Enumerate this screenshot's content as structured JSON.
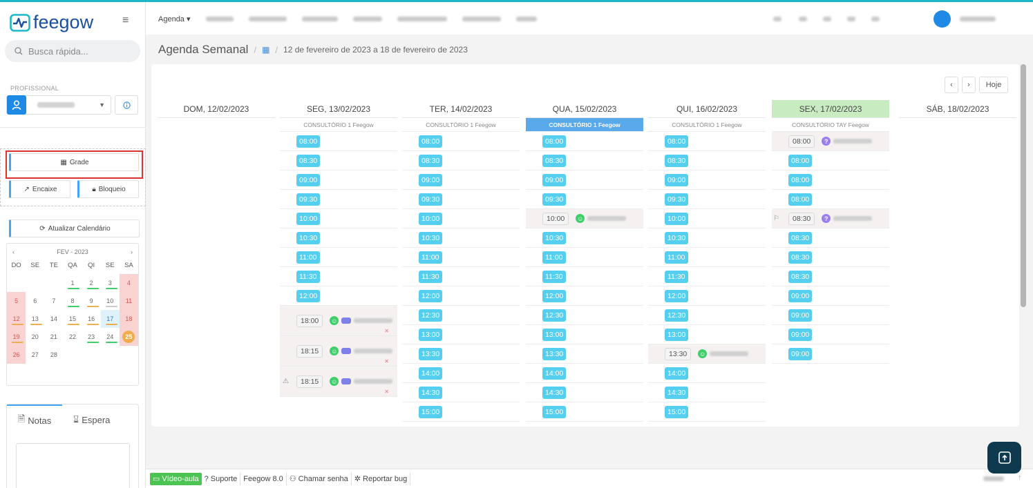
{
  "app": {
    "logo": "feegow"
  },
  "search": {
    "placeholder": "Busca rápida..."
  },
  "professional": {
    "label": "PROFISSIONAL"
  },
  "buttons": {
    "grade": "Grade",
    "encaixe": "Encaixe",
    "bloqueio": "Bloqueio",
    "refresh": "Atualizar Calendário"
  },
  "topnav": {
    "agenda": "Agenda"
  },
  "calendar": {
    "month": "FEV - 2023",
    "dow": [
      "DO",
      "SE",
      "TE",
      "QA",
      "QI",
      "SE",
      "SA"
    ],
    "weeks": [
      [
        "",
        "",
        "",
        "1",
        "2",
        "3",
        "4"
      ],
      [
        "5",
        "6",
        "7",
        "8",
        "9",
        "10",
        "11"
      ],
      [
        "12",
        "13",
        "14",
        "15",
        "16",
        "17",
        "18"
      ],
      [
        "19",
        "20",
        "21",
        "22",
        "23",
        "24",
        "25"
      ],
      [
        "26",
        "27",
        "28",
        "",
        "",
        "",
        ""
      ]
    ],
    "colors": {
      "weekend": "#f8d3d1",
      "today": "#dff1fb",
      "green": "#3fce6a",
      "orange": "#f0ad4e",
      "gray": "#cccccc"
    }
  },
  "notes": {
    "tab_notes": "Notas",
    "tab_wait": "Espera"
  },
  "breadcrumb": {
    "title": "Agenda Semanal",
    "range": "12 de fevereiro de 2023 a 18 de fevereiro de 2023"
  },
  "week_nav": {
    "today": "Hoje"
  },
  "days": [
    {
      "label": "DOM, 12/02/2023",
      "room": ""
    },
    {
      "label": "SEG, 13/02/2023",
      "room": "CONSULTÓRIO 1 Feegow"
    },
    {
      "label": "TER, 14/02/2023",
      "room": "CONSULTÓRIO 1 Feegow"
    },
    {
      "label": "QUA, 15/02/2023",
      "room": "CONSULTÓRIO 1 Feegow"
    },
    {
      "label": "QUI, 16/02/2023",
      "room": "CONSULTÓRIO 1 Feegow"
    },
    {
      "label": "SEX, 17/02/2023",
      "room": "CONSULTÓRIO TAY Feegow"
    },
    {
      "label": "SÁB, 18/02/2023",
      "room": ""
    }
  ],
  "slots": {
    "seg": [
      {
        "t": "08:00"
      },
      {
        "t": "08:30"
      },
      {
        "t": "09:00"
      },
      {
        "t": "09:30"
      },
      {
        "t": "10:00"
      },
      {
        "t": "10:30"
      },
      {
        "t": "11:00"
      },
      {
        "t": "11:30"
      },
      {
        "t": "12:00"
      },
      {
        "t": "18:00",
        "appt": true,
        "status": "green",
        "tag": true
      },
      {
        "t": "18:15",
        "appt": true,
        "status": "green",
        "tag": true
      },
      {
        "t": "18:15",
        "appt": true,
        "status": "green",
        "tag": true,
        "warn": true
      }
    ],
    "ter": [
      {
        "t": "08:00"
      },
      {
        "t": "08:30"
      },
      {
        "t": "09:00"
      },
      {
        "t": "09:30"
      },
      {
        "t": "10:00"
      },
      {
        "t": "10:30"
      },
      {
        "t": "11:00"
      },
      {
        "t": "11:30"
      },
      {
        "t": "12:00"
      },
      {
        "t": "12:30"
      },
      {
        "t": "13:00"
      },
      {
        "t": "13:30"
      },
      {
        "t": "14:00"
      },
      {
        "t": "14:30"
      },
      {
        "t": "15:00"
      }
    ],
    "qua": [
      {
        "t": "08:00"
      },
      {
        "t": "08:30"
      },
      {
        "t": "09:00"
      },
      {
        "t": "09:30"
      },
      {
        "t": "10:00",
        "appt": true,
        "status": "green"
      },
      {
        "t": "10:30"
      },
      {
        "t": "11:00"
      },
      {
        "t": "11:30"
      },
      {
        "t": "12:00"
      },
      {
        "t": "12:30"
      },
      {
        "t": "13:00"
      },
      {
        "t": "13:30"
      },
      {
        "t": "14:00"
      },
      {
        "t": "14:30"
      },
      {
        "t": "15:00"
      }
    ],
    "qui": [
      {
        "t": "08:00"
      },
      {
        "t": "08:30"
      },
      {
        "t": "09:00"
      },
      {
        "t": "09:30"
      },
      {
        "t": "10:00"
      },
      {
        "t": "10:30"
      },
      {
        "t": "11:00"
      },
      {
        "t": "11:30"
      },
      {
        "t": "12:00"
      },
      {
        "t": "12:30"
      },
      {
        "t": "13:00"
      },
      {
        "t": "13:30",
        "appt": true,
        "status": "green"
      },
      {
        "t": "14:00"
      },
      {
        "t": "14:30"
      },
      {
        "t": "15:00"
      }
    ],
    "sex": [
      {
        "t": "08:00",
        "appt": true,
        "status": "purple"
      },
      {
        "t": "08:00"
      },
      {
        "t": "08:00"
      },
      {
        "t": "08:00"
      },
      {
        "t": "08:30",
        "appt": true,
        "status": "purple",
        "flag": true
      },
      {
        "t": "08:30"
      },
      {
        "t": "08:30"
      },
      {
        "t": "08:30"
      },
      {
        "t": "09:00"
      },
      {
        "t": "09:00"
      },
      {
        "t": "09:00"
      },
      {
        "t": "09:00"
      }
    ]
  },
  "footer": {
    "video": "Vídeo-aula",
    "support": "Suporte",
    "version": "Feegow 8.0",
    "call": "Chamar senha",
    "bug": "Reportar bug"
  }
}
